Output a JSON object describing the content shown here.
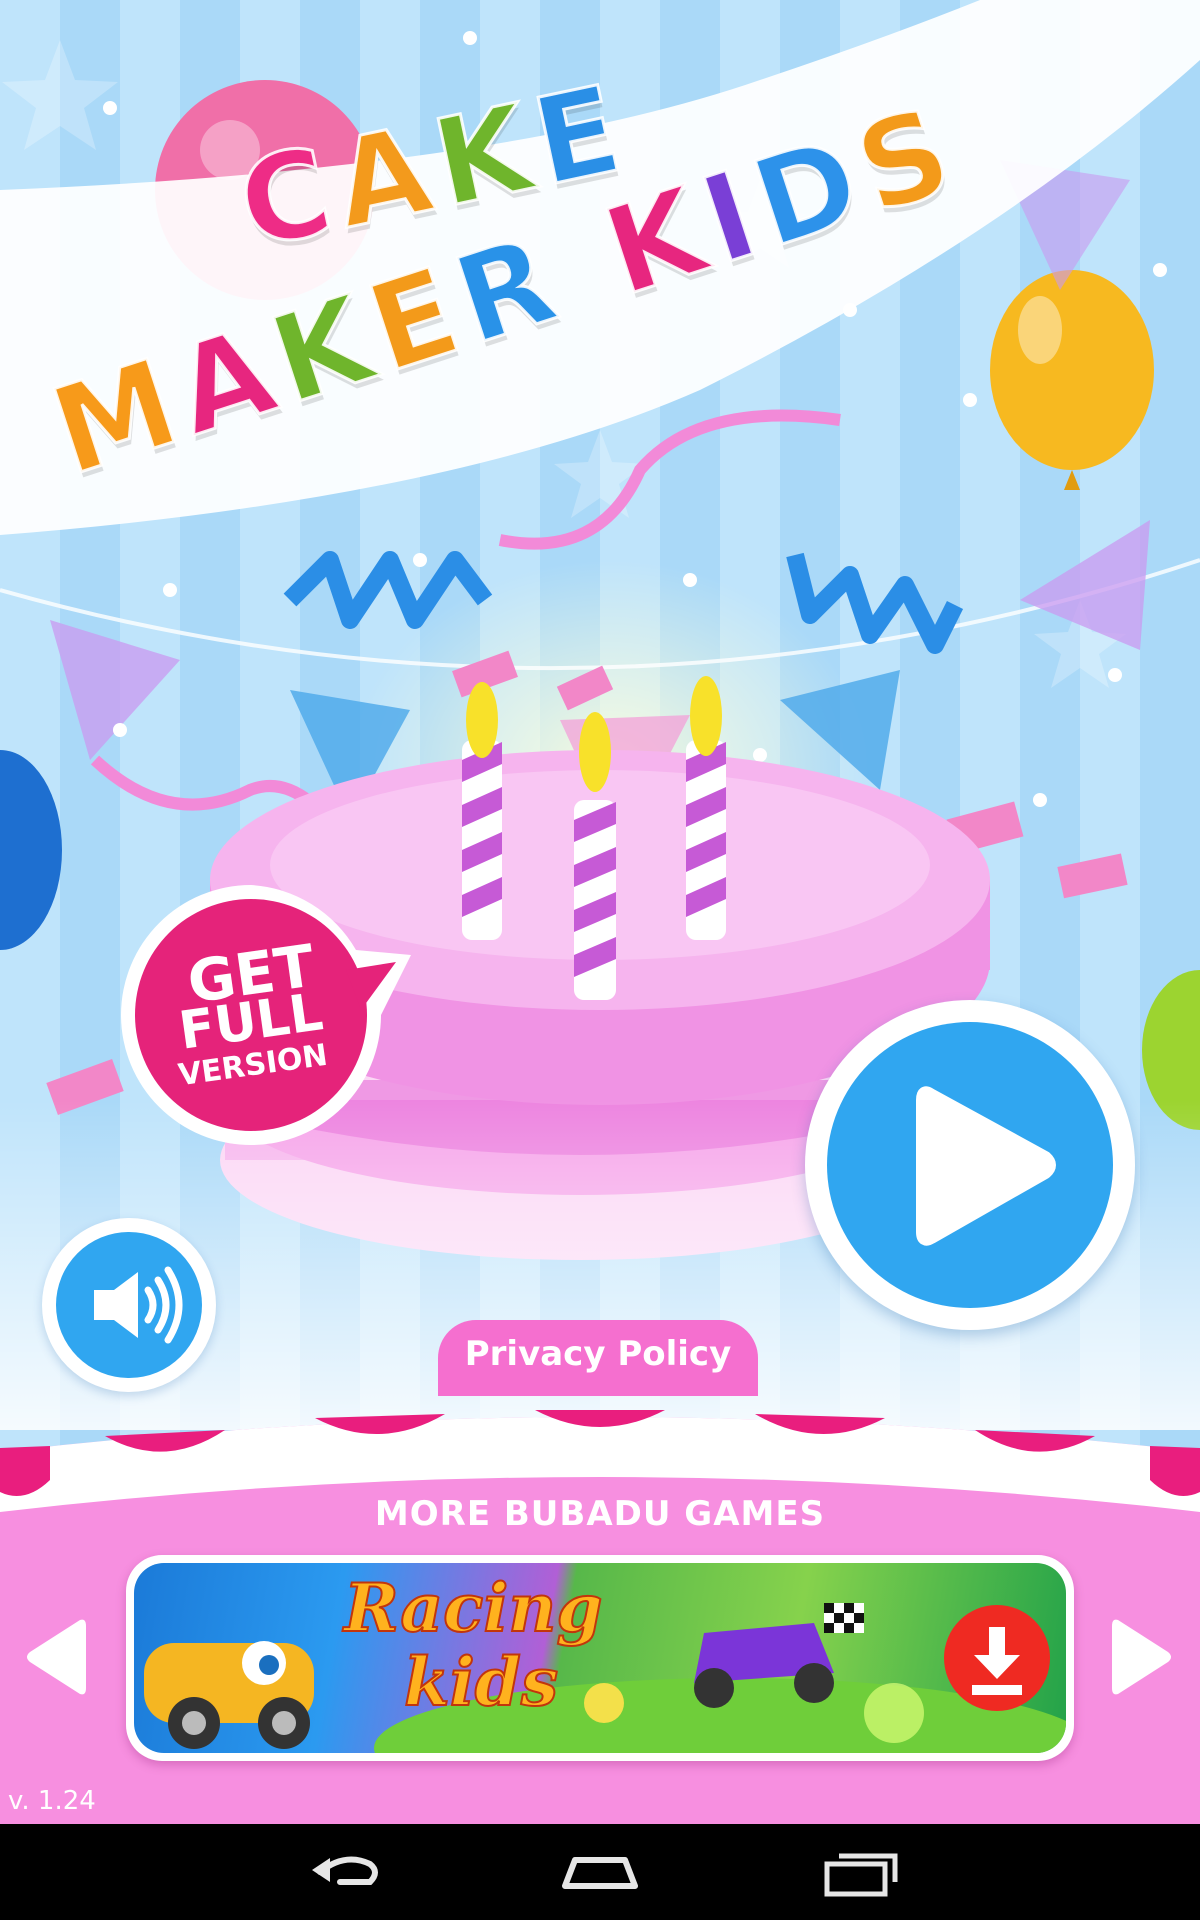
{
  "app": {
    "title_line1": [
      "C",
      "A",
      "K",
      "E"
    ],
    "title_line2": [
      "M",
      "A",
      "K",
      "E",
      "R",
      "K",
      "I",
      "D",
      "S"
    ],
    "title_line1_colors": [
      "#ee2c86",
      "#f39a1c",
      "#6fb52c",
      "#2a8fe6"
    ],
    "title_line2_colors": [
      "#f79a1a",
      "#e7267f",
      "#f2a81e",
      "#72b530",
      "#f39a1a",
      "#2992e8",
      "#e7267f",
      "#7a3fd6",
      "#2d92ea",
      "#f39a1a"
    ]
  },
  "buttons": {
    "play": "play-icon",
    "get_full": {
      "line1": "GET",
      "line2": "FULL",
      "line3": "VERSION",
      "color": "#e5237a"
    },
    "sound": "speaker-icon",
    "privacy_label": "Privacy Policy"
  },
  "more_games": {
    "title": "MORE BUBADU GAMES",
    "card": {
      "name_line1": "Racing",
      "name_line2": "kids",
      "download_icon": "download-icon"
    },
    "arrows": [
      "arrow-left-icon",
      "arrow-right-icon"
    ]
  },
  "version": "v. 1.24",
  "colors": {
    "accent_blue": "#30a6f0",
    "accent_pink": "#e5237a",
    "panel_pink": "#f78fe0",
    "scallop": "#e91e7e"
  },
  "system_nav": [
    "back-icon",
    "home-icon",
    "recents-icon"
  ]
}
